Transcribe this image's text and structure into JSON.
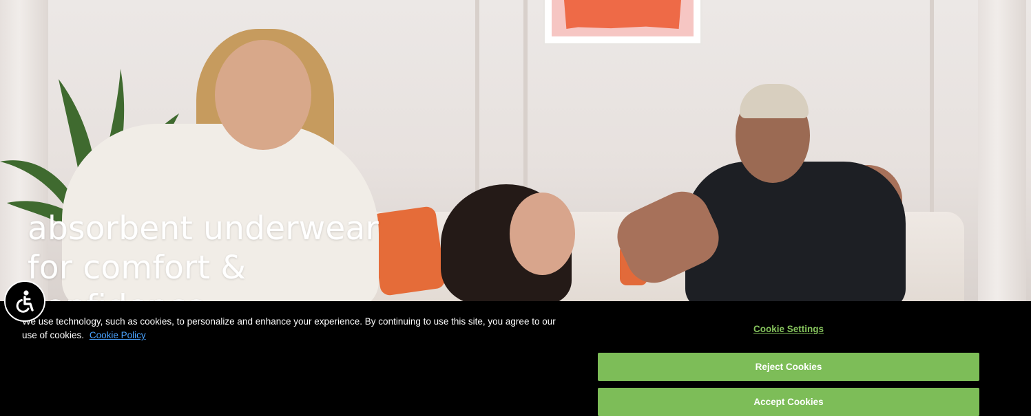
{
  "hero": {
    "title_line1": "absorbent underwear",
    "title_line2": "for comfort &",
    "title_line3": "confidence"
  },
  "accessibility": {
    "icon": "accessibility-icon"
  },
  "cookie_banner": {
    "message": "We use technology, such as cookies, to personalize and enhance your experience. By continuing to use this site, you agree to our use of cookies.",
    "policy_link": "Cookie Policy",
    "settings_label": "Cookie Settings",
    "reject_label": "Reject Cookies",
    "accept_label": "Accept Cookies",
    "accent_color": "#7dbd58"
  }
}
